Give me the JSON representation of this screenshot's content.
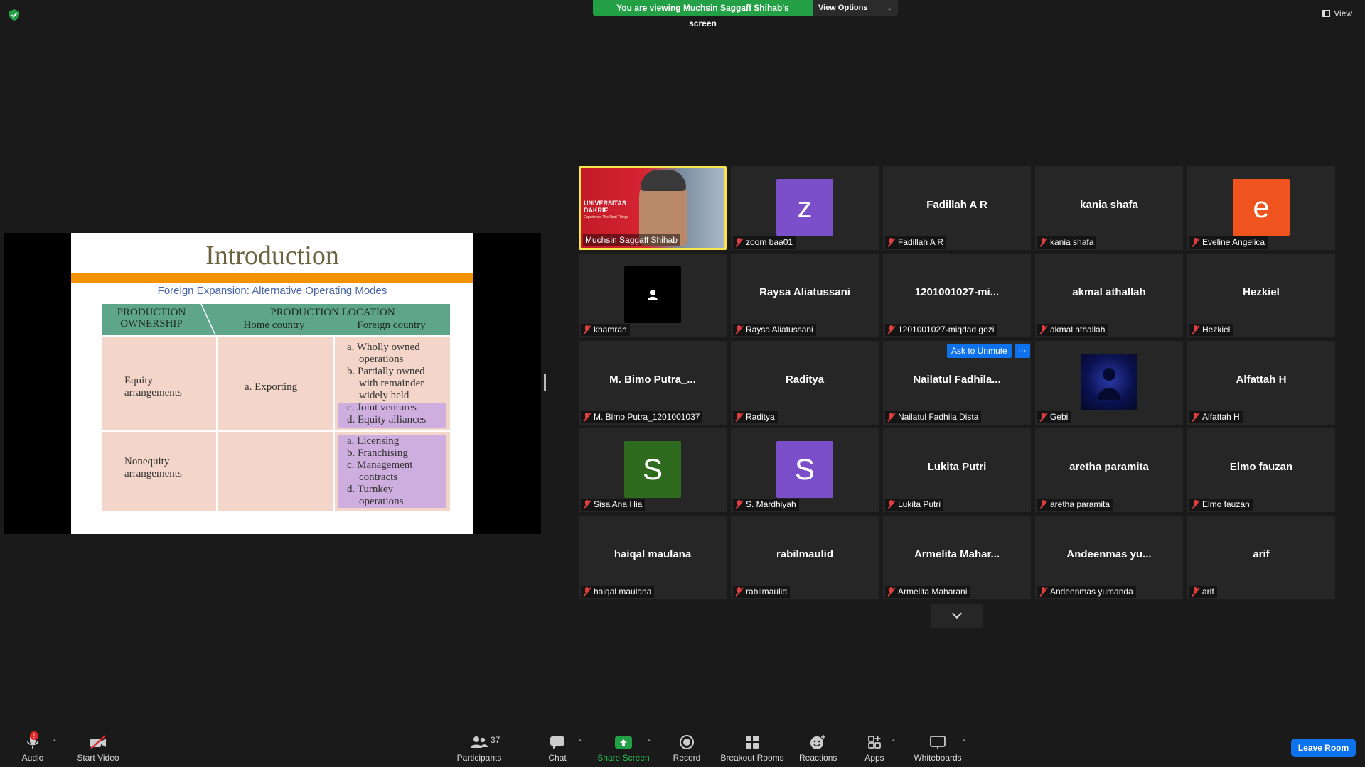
{
  "banner": {
    "viewing_text": "You are viewing Muchsin Saggaff Shihab's screen",
    "view_options": "View Options"
  },
  "top_right": {
    "view_label": "View"
  },
  "slide": {
    "title": "Introduction",
    "subtitle": "Foreign Expansion: Alternative Operating Modes",
    "header_ownership_1": "PRODUCTION",
    "header_ownership_2": "OWNERSHIP",
    "header_location": "PRODUCTION LOCATION",
    "header_home": "Home country",
    "header_foreign": "Foreign country",
    "row1_label_1": "Equity",
    "row1_label_2": "arrangements",
    "row1_home": "a. Exporting",
    "row1_foreign": [
      "a. Wholly owned",
      "operations",
      "b. Partially owned",
      "with remainder",
      "widely held",
      "c. Joint ventures",
      "d. Equity alliances"
    ],
    "row2_label_1": "Nonequity",
    "row2_label_2": "arrangements",
    "row2_foreign": [
      "a. Licensing",
      "b. Franchising",
      "c. Management",
      "contracts",
      "d. Turnkey",
      "operations"
    ]
  },
  "speaker_video": {
    "uni_line1": "UNIVERSITAS",
    "uni_line2": "BAKRIE",
    "tagline": "Experience The Real Things"
  },
  "participants": [
    {
      "label": "Muchsin Saggaff Shihab",
      "muted": false,
      "kind": "video"
    },
    {
      "label": "zoom baa01",
      "muted": true,
      "kind": "avatar",
      "letter": "z",
      "color": "#7b4fc9"
    },
    {
      "label": "Fadillah A R",
      "big": "Fadillah A R",
      "muted": true,
      "kind": "name"
    },
    {
      "label": "kania shafa",
      "big": "kania shafa",
      "muted": true,
      "kind": "name"
    },
    {
      "label": "Eveline Angelica",
      "muted": true,
      "kind": "avatar",
      "letter": "e",
      "color": "#f0541e"
    },
    {
      "label": "khamran",
      "muted": true,
      "kind": "photo-person"
    },
    {
      "label": "Raysa Aliatussani",
      "big": "Raysa Aliatussani",
      "muted": true,
      "kind": "name"
    },
    {
      "label": "1201001027-miqdad gozi",
      "big": "1201001027-mi...",
      "muted": true,
      "kind": "name"
    },
    {
      "label": "akmal athallah",
      "big": "akmal athallah",
      "muted": true,
      "kind": "name"
    },
    {
      "label": "Hezkiel",
      "big": "Hezkiel",
      "muted": true,
      "kind": "name"
    },
    {
      "label": "M. Bimo Putra_1201001037",
      "big": "M. Bimo Putra_...",
      "muted": true,
      "kind": "name"
    },
    {
      "label": "Raditya",
      "big": "Raditya",
      "muted": true,
      "kind": "name"
    },
    {
      "label": "Nailatul Fadhila Dista",
      "big": "Nailatul  Fadhila...",
      "muted": true,
      "kind": "name"
    },
    {
      "label": "Gebi",
      "muted": true,
      "kind": "photo-dark"
    },
    {
      "label": "Alfattah H",
      "big": "Alfattah H",
      "muted": true,
      "kind": "name"
    },
    {
      "label": "Sisa'Ana Hia",
      "muted": true,
      "kind": "avatar",
      "letter": "S",
      "color": "#2e6b1e"
    },
    {
      "label": "S. Mardhiyah",
      "muted": true,
      "kind": "avatar",
      "letter": "S",
      "color": "#7b4fc9"
    },
    {
      "label": "Lukita Putri",
      "big": "Lukita Putri",
      "muted": true,
      "kind": "name"
    },
    {
      "label": "aretha paramita",
      "big": "aretha paramita",
      "muted": true,
      "kind": "name"
    },
    {
      "label": "Elmo fauzan",
      "big": "Elmo fauzan",
      "muted": true,
      "kind": "name"
    },
    {
      "label": "haiqal maulana",
      "big": "haiqal maulana",
      "muted": true,
      "kind": "name"
    },
    {
      "label": "rabilmaulid",
      "big": "rabilmaulid",
      "muted": true,
      "kind": "name"
    },
    {
      "label": "Armelita Maharani",
      "big": "Armelita  Mahar...",
      "muted": true,
      "kind": "name"
    },
    {
      "label": "Andeenmas yumanda",
      "big": "Andeenmas  yu...",
      "muted": true,
      "kind": "name"
    },
    {
      "label": "arif",
      "big": "arif",
      "muted": true,
      "kind": "name"
    }
  ],
  "ask_unmute": {
    "label": "Ask to Unmute",
    "more": "···"
  },
  "toolbar": {
    "audio": "Audio",
    "audio_badge": "!",
    "start_video": "Start Video",
    "participants": "Participants",
    "participants_count": "37",
    "chat": "Chat",
    "share_screen": "Share Screen",
    "record": "Record",
    "breakout_rooms": "Breakout Rooms",
    "reactions": "Reactions",
    "apps": "Apps",
    "whiteboards": "Whiteboards",
    "leave": "Leave Room"
  },
  "colors": {
    "share_green": "#23a046",
    "accent_blue": "#0e72ed",
    "active_speaker": "#f6e64c",
    "mute_red": "#e03e3e"
  }
}
